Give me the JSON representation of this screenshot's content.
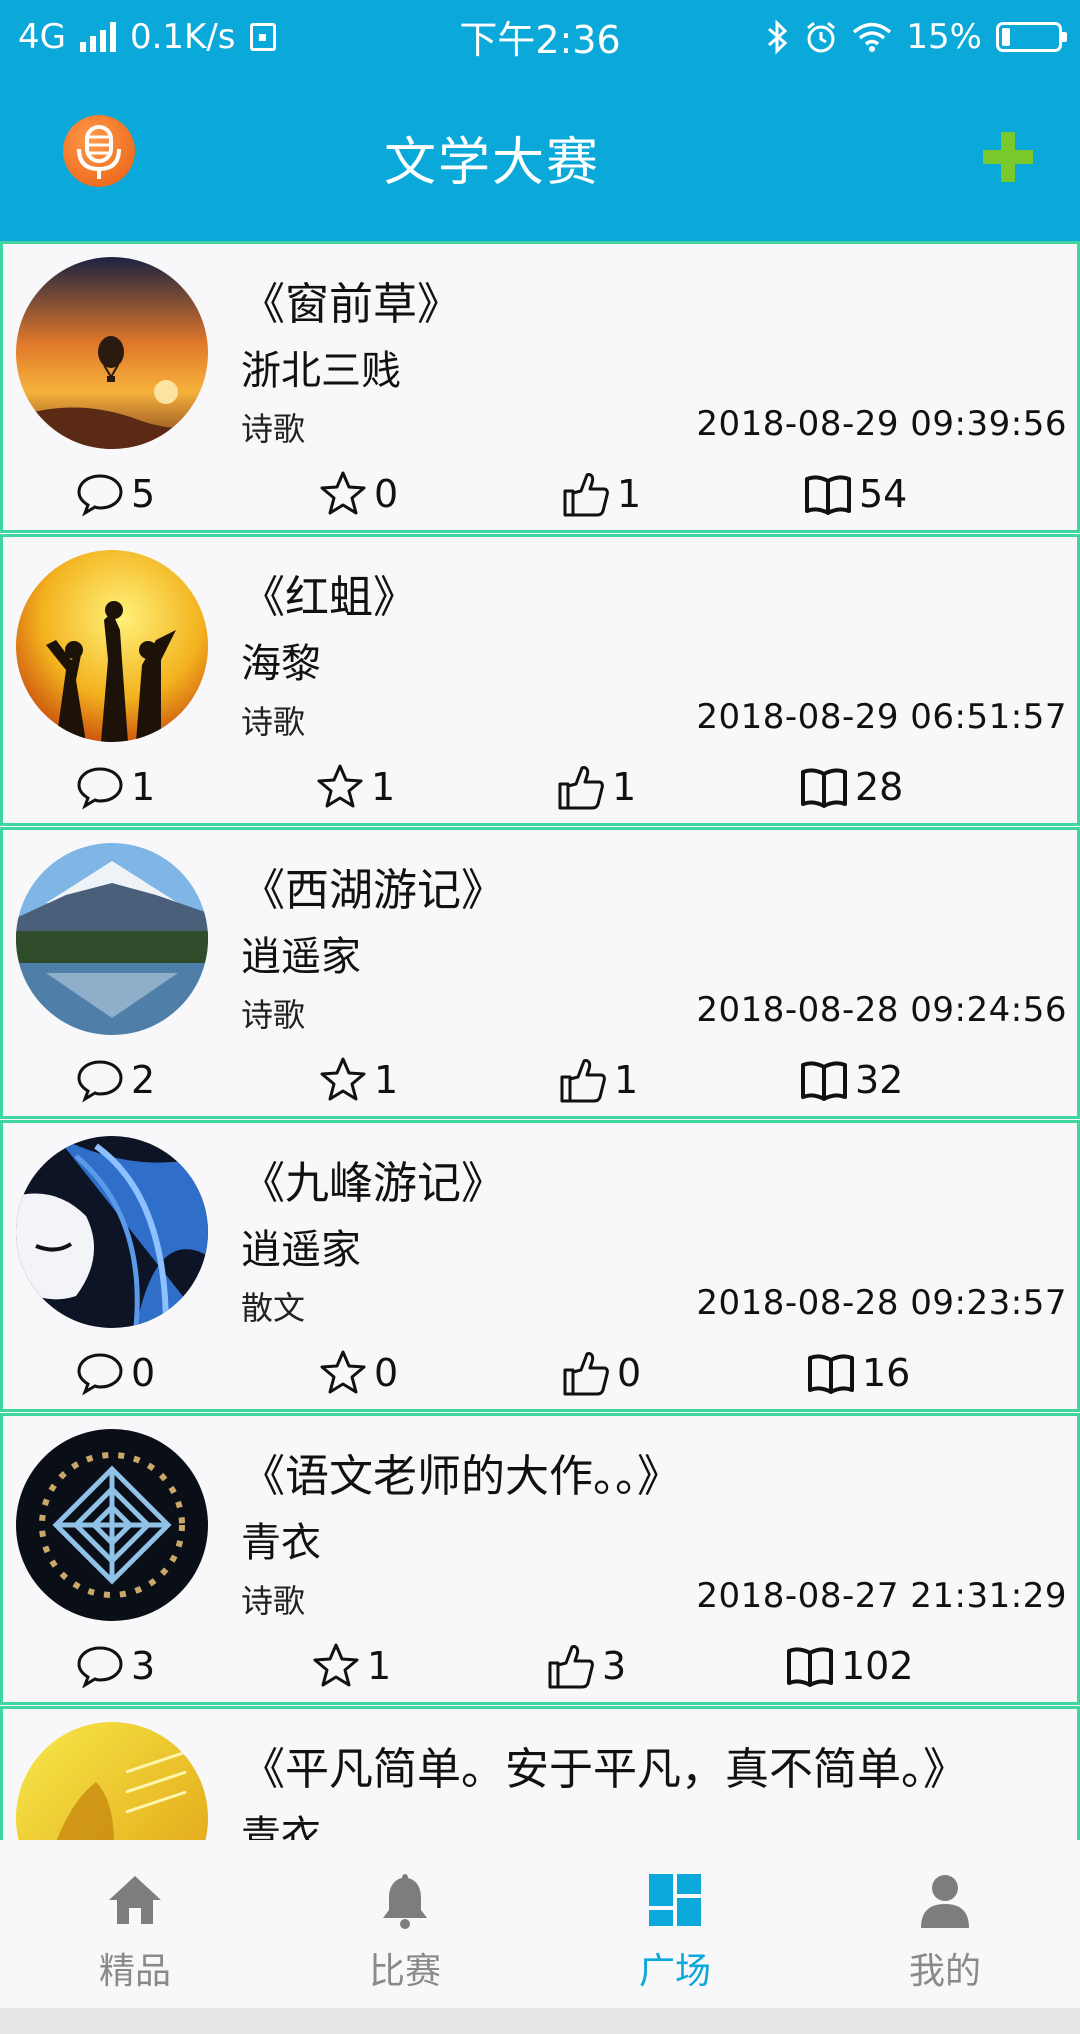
{
  "status_bar": {
    "network": "4G",
    "speed": "0.1K/s",
    "time": "下午2:36",
    "battery": "15%",
    "battery_level": 0.15,
    "icons": [
      "signal-icon",
      "sim-icon",
      "bluetooth-icon",
      "alarm-icon",
      "wifi-icon",
      "battery-icon"
    ]
  },
  "app_bar": {
    "title": "文学大赛",
    "logo_icon": "microphone-logo-icon",
    "add_icon": "plus-icon",
    "accent_color": "#0aa9d9",
    "add_color": "#7ac92a"
  },
  "colors": {
    "card_border": "#3fd6a0",
    "active_tab": "#0aa9d9",
    "inactive_tab": "#8a8a8a"
  },
  "works": [
    {
      "title": "《窗前草》",
      "author": "浙北三贱",
      "genre": "诗歌",
      "time": "2018-08-29 09:39:56",
      "comments": "5",
      "favorites": "0",
      "likes": "1",
      "reads": "54",
      "avatar": "hot-air-balloon-sunset"
    },
    {
      "title": "《红蛆》",
      "author": "海黎",
      "genre": "诗歌",
      "time": "2018-08-29 06:51:57",
      "comments": "1",
      "favorites": "1",
      "likes": "1",
      "reads": "28",
      "avatar": "dancing-silhouettes"
    },
    {
      "title": "《西湖游记》",
      "author": "逍遥家",
      "genre": "诗歌",
      "time": "2018-08-28 09:24:56",
      "comments": "2",
      "favorites": "1",
      "likes": "1",
      "reads": "32",
      "avatar": "mountain-lake"
    },
    {
      "title": "《九峰游记》",
      "author": "逍遥家",
      "genre": "散文",
      "time": "2018-08-28 09:23:57",
      "comments": "0",
      "favorites": "0",
      "likes": "0",
      "reads": "16",
      "avatar": "blue-ink-face"
    },
    {
      "title": "《语文老师的大作。。》",
      "author": "青衣",
      "genre": "诗歌",
      "time": "2018-08-27 21:31:29",
      "comments": "3",
      "favorites": "1",
      "likes": "3",
      "reads": "102",
      "avatar": "blue-lattice"
    },
    {
      "title": "《平凡简单。安于平凡，真不简单。》",
      "author": "青衣",
      "avatar": "yellow-guitar"
    }
  ],
  "bottom_nav": [
    {
      "label": "精品",
      "icon": "home-icon",
      "active": false
    },
    {
      "label": "比赛",
      "icon": "bell-icon",
      "active": false
    },
    {
      "label": "广场",
      "icon": "grid-icon",
      "active": true
    },
    {
      "label": "我的",
      "icon": "user-icon",
      "active": false
    }
  ]
}
